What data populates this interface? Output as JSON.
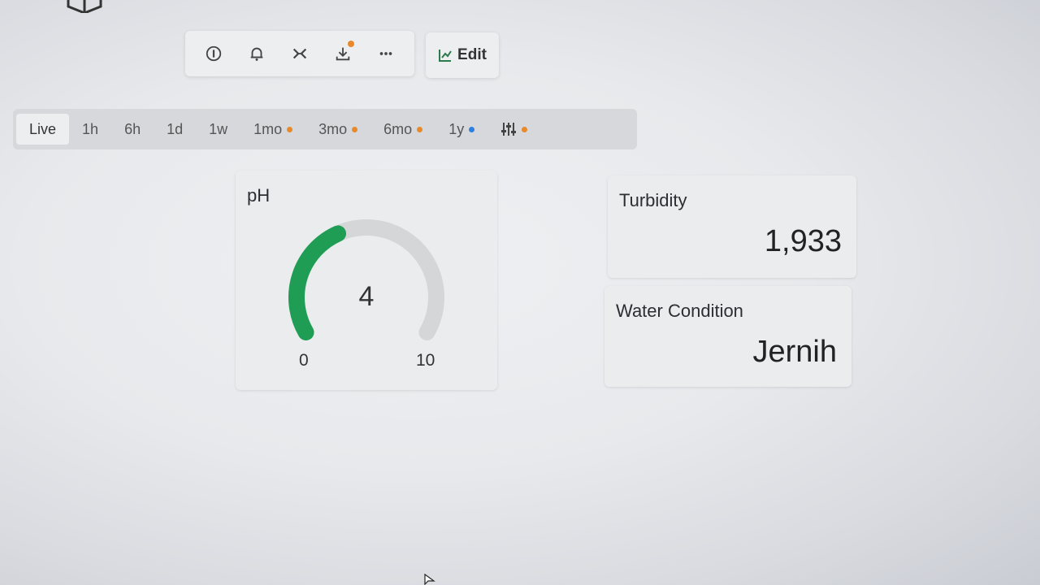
{
  "toolbar": {
    "icons": [
      "info-icon",
      "bell-icon",
      "shuffle-icon",
      "download-icon",
      "more-icon"
    ],
    "download_dot_color": "#e8892b",
    "edit_label": "Edit"
  },
  "time_range": {
    "tabs": [
      {
        "label": "Live",
        "active": true
      },
      {
        "label": "1h"
      },
      {
        "label": "6h"
      },
      {
        "label": "1d"
      },
      {
        "label": "1w"
      },
      {
        "label": "1mo",
        "dot": "#e8892b"
      },
      {
        "label": "3mo",
        "dot": "#e8892b"
      },
      {
        "label": "6mo",
        "dot": "#e8892b"
      },
      {
        "label": "1y",
        "dot": "#2f7fe0"
      }
    ],
    "filter_dot": "#e8892b"
  },
  "ph_gauge": {
    "title": "pH",
    "value": "4",
    "min": "0",
    "max": "10",
    "fraction": 0.4,
    "fill_color": "#1f9d55",
    "track_color": "#d5d6d8"
  },
  "turbidity": {
    "title": "Turbidity",
    "value": "1,933"
  },
  "water_condition": {
    "title": "Water Condition",
    "value": "Jernih"
  }
}
